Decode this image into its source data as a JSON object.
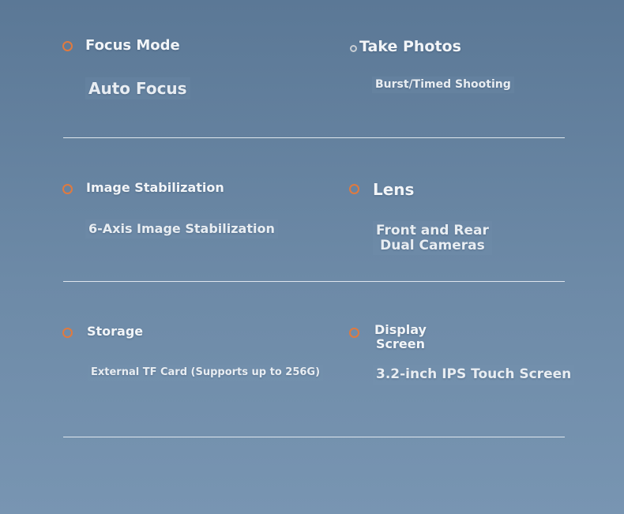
{
  "specs": [
    {
      "label": "Focus Mode",
      "value": "Auto Focus"
    },
    {
      "label": "Take Photos",
      "value": "Burst/Timed Shooting"
    },
    {
      "label": "Image Stabilization",
      "value": "6-Axis Image Stabilization"
    },
    {
      "label": "Lens",
      "value_line1": "Front and Rear",
      "value_line2": "Dual Cameras"
    },
    {
      "label": "Storage",
      "value": "External TF Card (Supports up to 256G)"
    },
    {
      "label_line1": "Display",
      "label_line2": "Screen",
      "value": "3.2-inch IPS Touch Screen"
    }
  ],
  "colors": {
    "bullet_accent": "#e07a3f",
    "bullet_neutral": "#c7cdd3",
    "text": "#f2f5f8",
    "divider": "#dfe6ed"
  }
}
